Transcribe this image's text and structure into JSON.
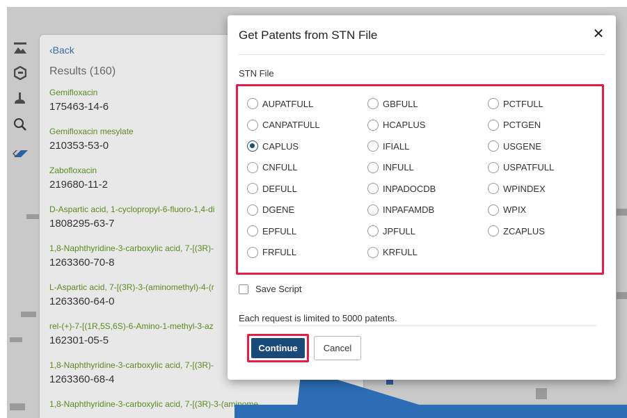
{
  "background": {
    "back_label": "Back",
    "results_count": "Results (160)",
    "results": [
      {
        "name": "Gemifloxacin",
        "rn": "175463-14-6"
      },
      {
        "name": "Gemifloxacin mesylate",
        "rn": "210353-53-0"
      },
      {
        "name": "Zabofloxacin",
        "rn": "219680-11-2"
      },
      {
        "name": "D-Aspartic acid, 1-cyclopropyl-6-fluoro-1,4-di",
        "rn": "1808295-63-7"
      },
      {
        "name": "1,8-Naphthyridine-3-carboxylic acid, 7-[(3R)-",
        "rn": "1263360-70-8"
      },
      {
        "name": "L-Aspartic acid, 7-[(3R)-3-(aminomethyl)-4-(r",
        "rn": "1263360-64-0"
      },
      {
        "name": "rel-(+)-7-[(1R,5S,6S)-6-Amino-1-methyl-3-az",
        "rn": "162301-05-5"
      },
      {
        "name": "1,8-Naphthyridine-3-carboxylic acid, 7-[(3R)-",
        "rn": "1263360-68-4"
      },
      {
        "name": "1,8-Naphthyridine-3-carboxylic acid, 7-[(3R)-3-(aminome",
        "rn": ""
      }
    ]
  },
  "dialog": {
    "title": "Get Patents from STN File",
    "close_glyph": "✕",
    "field_label": "STN File",
    "options": [
      {
        "label": "AUPATFULL",
        "checked": false
      },
      {
        "label": "GBFULL",
        "checked": false
      },
      {
        "label": "PCTFULL",
        "checked": false
      },
      {
        "label": "CANPATFULL",
        "checked": false
      },
      {
        "label": "HCAPLUS",
        "checked": false
      },
      {
        "label": "PCTGEN",
        "checked": false
      },
      {
        "label": "CAPLUS",
        "checked": true
      },
      {
        "label": "IFIALL",
        "checked": false
      },
      {
        "label": "USGENE",
        "checked": false
      },
      {
        "label": "CNFULL",
        "checked": false
      },
      {
        "label": "INFULL",
        "checked": false
      },
      {
        "label": "USPATFULL",
        "checked": false
      },
      {
        "label": "DEFULL",
        "checked": false
      },
      {
        "label": "INPADOCDB",
        "checked": false
      },
      {
        "label": "WPINDEX",
        "checked": false
      },
      {
        "label": "DGENE",
        "checked": false
      },
      {
        "label": "INPAFAMDB",
        "checked": false
      },
      {
        "label": "WPIX",
        "checked": false
      },
      {
        "label": "EPFULL",
        "checked": false
      },
      {
        "label": "JPFULL",
        "checked": false
      },
      {
        "label": "ZCAPLUS",
        "checked": false
      },
      {
        "label": "FRFULL",
        "checked": false
      },
      {
        "label": "KRFULL",
        "checked": false
      }
    ],
    "save_script_label": "Save Script",
    "limit_text": "Each request is limited to 5000 patents.",
    "continue_label": "Continue",
    "cancel_label": "Cancel"
  },
  "colors": {
    "highlight": "#e11d48",
    "primary_button": "#1a4a78",
    "callout": "#2d6db5",
    "result_name": "#5a8a1e"
  }
}
